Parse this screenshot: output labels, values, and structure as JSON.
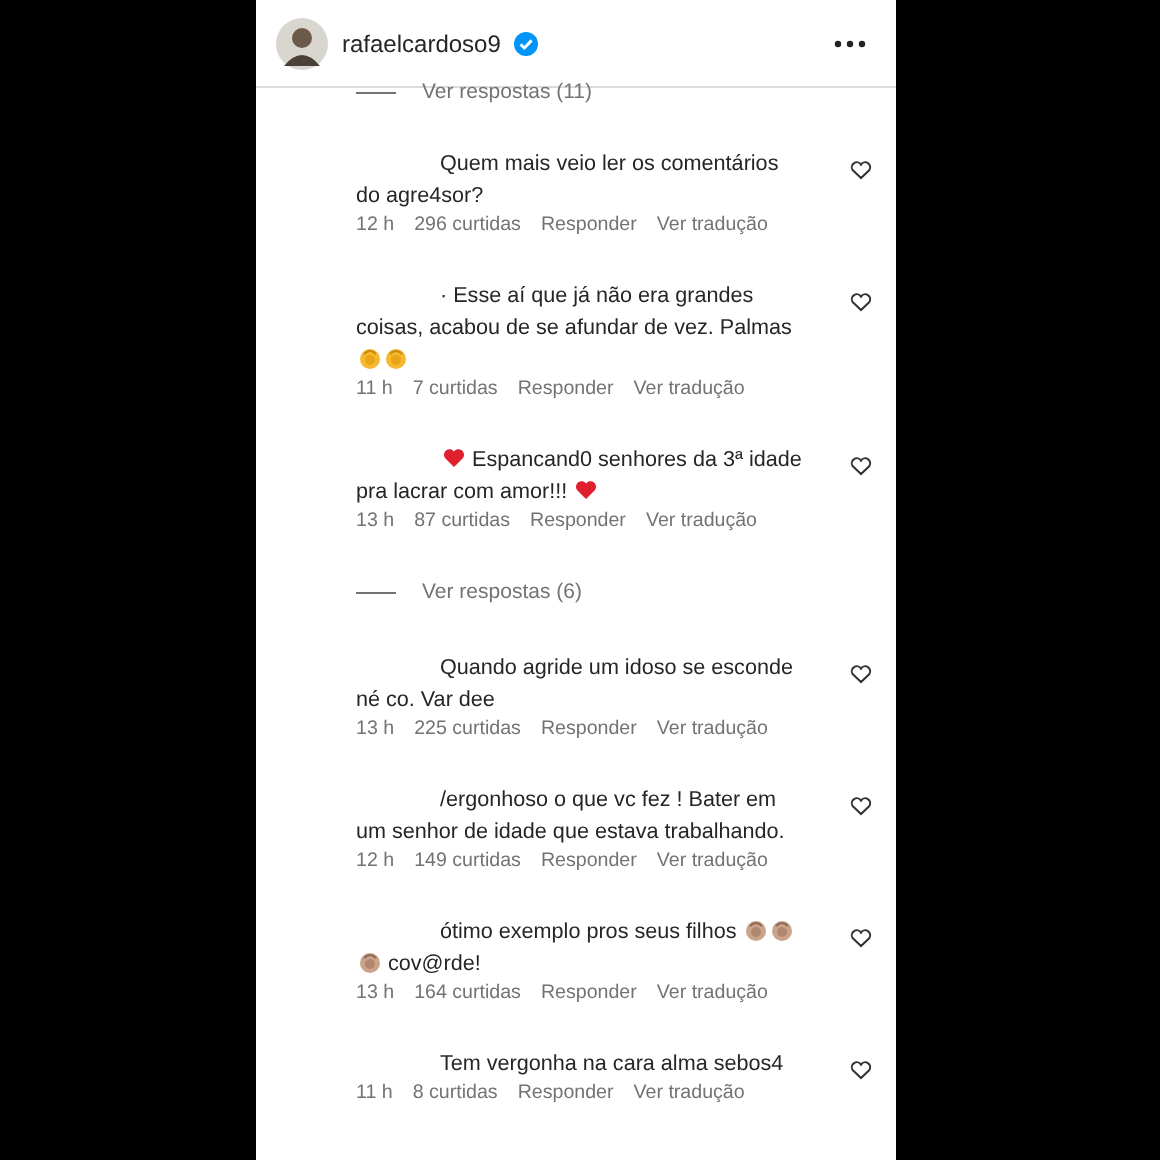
{
  "header": {
    "username": "rafaelcardoso9",
    "verified": true
  },
  "items": [
    {
      "kind": "replies",
      "label": "Ver respostas (11)"
    },
    {
      "kind": "comment",
      "parts": [
        {
          "kind": "text",
          "text": "Quem mais veio ler os comentários do agre4sor?"
        }
      ],
      "time": "12 h",
      "likes": "296 curtidas",
      "reply": "Responder",
      "translate": "Ver tradução"
    },
    {
      "kind": "comment",
      "parts": [
        {
          "kind": "text",
          "text": "· Esse aí que já não era grandes coisas, acabou de se afundar de vez. Palmas "
        },
        {
          "kind": "clap"
        },
        {
          "kind": "clap"
        }
      ],
      "time": "11 h",
      "likes": "7 curtidas",
      "reply": "Responder",
      "translate": "Ver tradução"
    },
    {
      "kind": "comment",
      "parts": [
        {
          "kind": "heart"
        },
        {
          "kind": "text",
          "text": " Espancand0 senhores da 3ª idade pra lacrar com amor!!! "
        },
        {
          "kind": "heart"
        }
      ],
      "time": "13 h",
      "likes": "87 curtidas",
      "reply": "Responder",
      "translate": "Ver tradução"
    },
    {
      "kind": "replies",
      "label": "Ver respostas (6)"
    },
    {
      "kind": "comment",
      "parts": [
        {
          "kind": "text",
          "text": "Quando agride um idoso se esconde né co. Var dee"
        }
      ],
      "time": "13 h",
      "likes": "225 curtidas",
      "reply": "Responder",
      "translate": "Ver tradução"
    },
    {
      "kind": "comment",
      "parts": [
        {
          "kind": "text",
          "text": "/ergonhoso o que vc fez ! Bater em um senhor de idade que estava trabalhando."
        }
      ],
      "time": "12 h",
      "likes": "149 curtidas",
      "reply": "Responder",
      "translate": "Ver tradução"
    },
    {
      "kind": "comment",
      "parts": [
        {
          "kind": "text",
          "text": "ótimo exemplo pros seus filhos "
        },
        {
          "kind": "clap2"
        },
        {
          "kind": "clap2"
        },
        {
          "kind": "clap2"
        },
        {
          "kind": "text",
          "text": " cov@rde!"
        }
      ],
      "time": "13 h",
      "likes": "164 curtidas",
      "reply": "Responder",
      "translate": "Ver tradução"
    },
    {
      "kind": "comment",
      "parts": [
        {
          "kind": "text",
          "text": "Tem vergonha na cara alma sebos4"
        }
      ],
      "time": "11 h",
      "likes": "8 curtidas",
      "reply": "Responder",
      "translate": "Ver tradução"
    }
  ]
}
